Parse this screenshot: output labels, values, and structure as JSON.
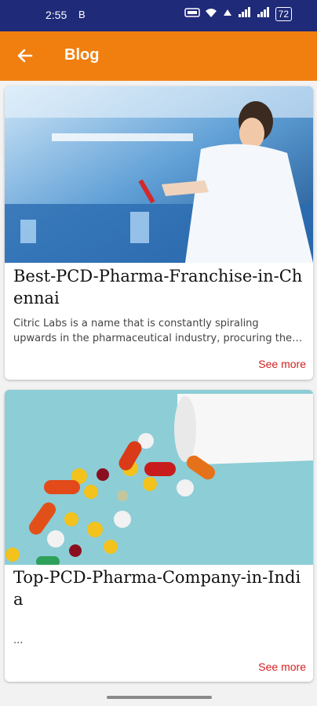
{
  "status_bar": {
    "time": "2:55",
    "b_icon": "B",
    "battery": "72",
    "icons": [
      "vowifi-icon",
      "wifi-icon",
      "volte-icon",
      "signal-icon",
      "signal-icon"
    ]
  },
  "app_bar": {
    "title": "Blog",
    "back_icon": "back-arrow-icon",
    "background_color": "#f07f10"
  },
  "posts": [
    {
      "title": "Best-PCD-Pharma-Franchise-in-Chennai",
      "description": "Citric Labs is a name that is constantly spiraling upwards in the pharmaceutical industry, procuring the best...",
      "see_more": "See more",
      "image": "scientist-lab-image"
    },
    {
      "title": "Top-PCD-Pharma-Company-in-India",
      "description": "...",
      "see_more": "See more",
      "image": "pills-bottle-image"
    }
  ],
  "colors": {
    "status_bar": "#1f2a78",
    "see_more": "#d32020"
  }
}
